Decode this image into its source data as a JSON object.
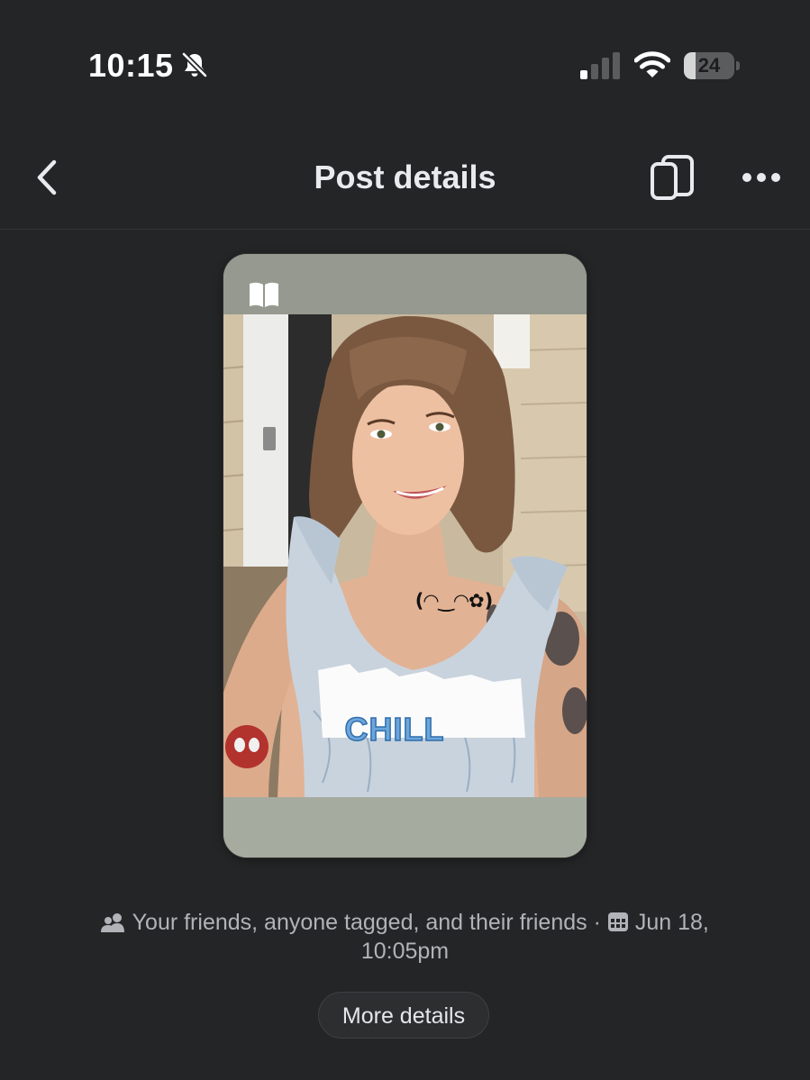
{
  "status_bar": {
    "time": "10:15",
    "battery_level": "24",
    "battery_percent": 24,
    "icons": [
      "bell-slash-icon",
      "cellular-signal-icon",
      "wifi-icon",
      "battery-icon"
    ]
  },
  "header": {
    "title": "Post details",
    "icons": [
      "chevron-left-icon",
      "switch-device-icon",
      "more-horizontal-icon"
    ]
  },
  "post": {
    "card_icon": "book-icon",
    "photo": {
      "emoticon": "(◠‿◠✿)",
      "sticker_text": "CHILL"
    }
  },
  "meta": {
    "audience_icon": "friends-icon",
    "audience": "Your friends, anyone tagged, and their friends",
    "separator": "·",
    "date_icon": "calendar-icon",
    "date": "Jun 18,",
    "time": "10:05pm"
  },
  "actions": {
    "more_details_label": "More details"
  },
  "colors": {
    "background": "#242526",
    "text_primary": "#e4e6eb",
    "text_secondary": "#b0b3b8",
    "card_frame": "#a6ab9f"
  }
}
